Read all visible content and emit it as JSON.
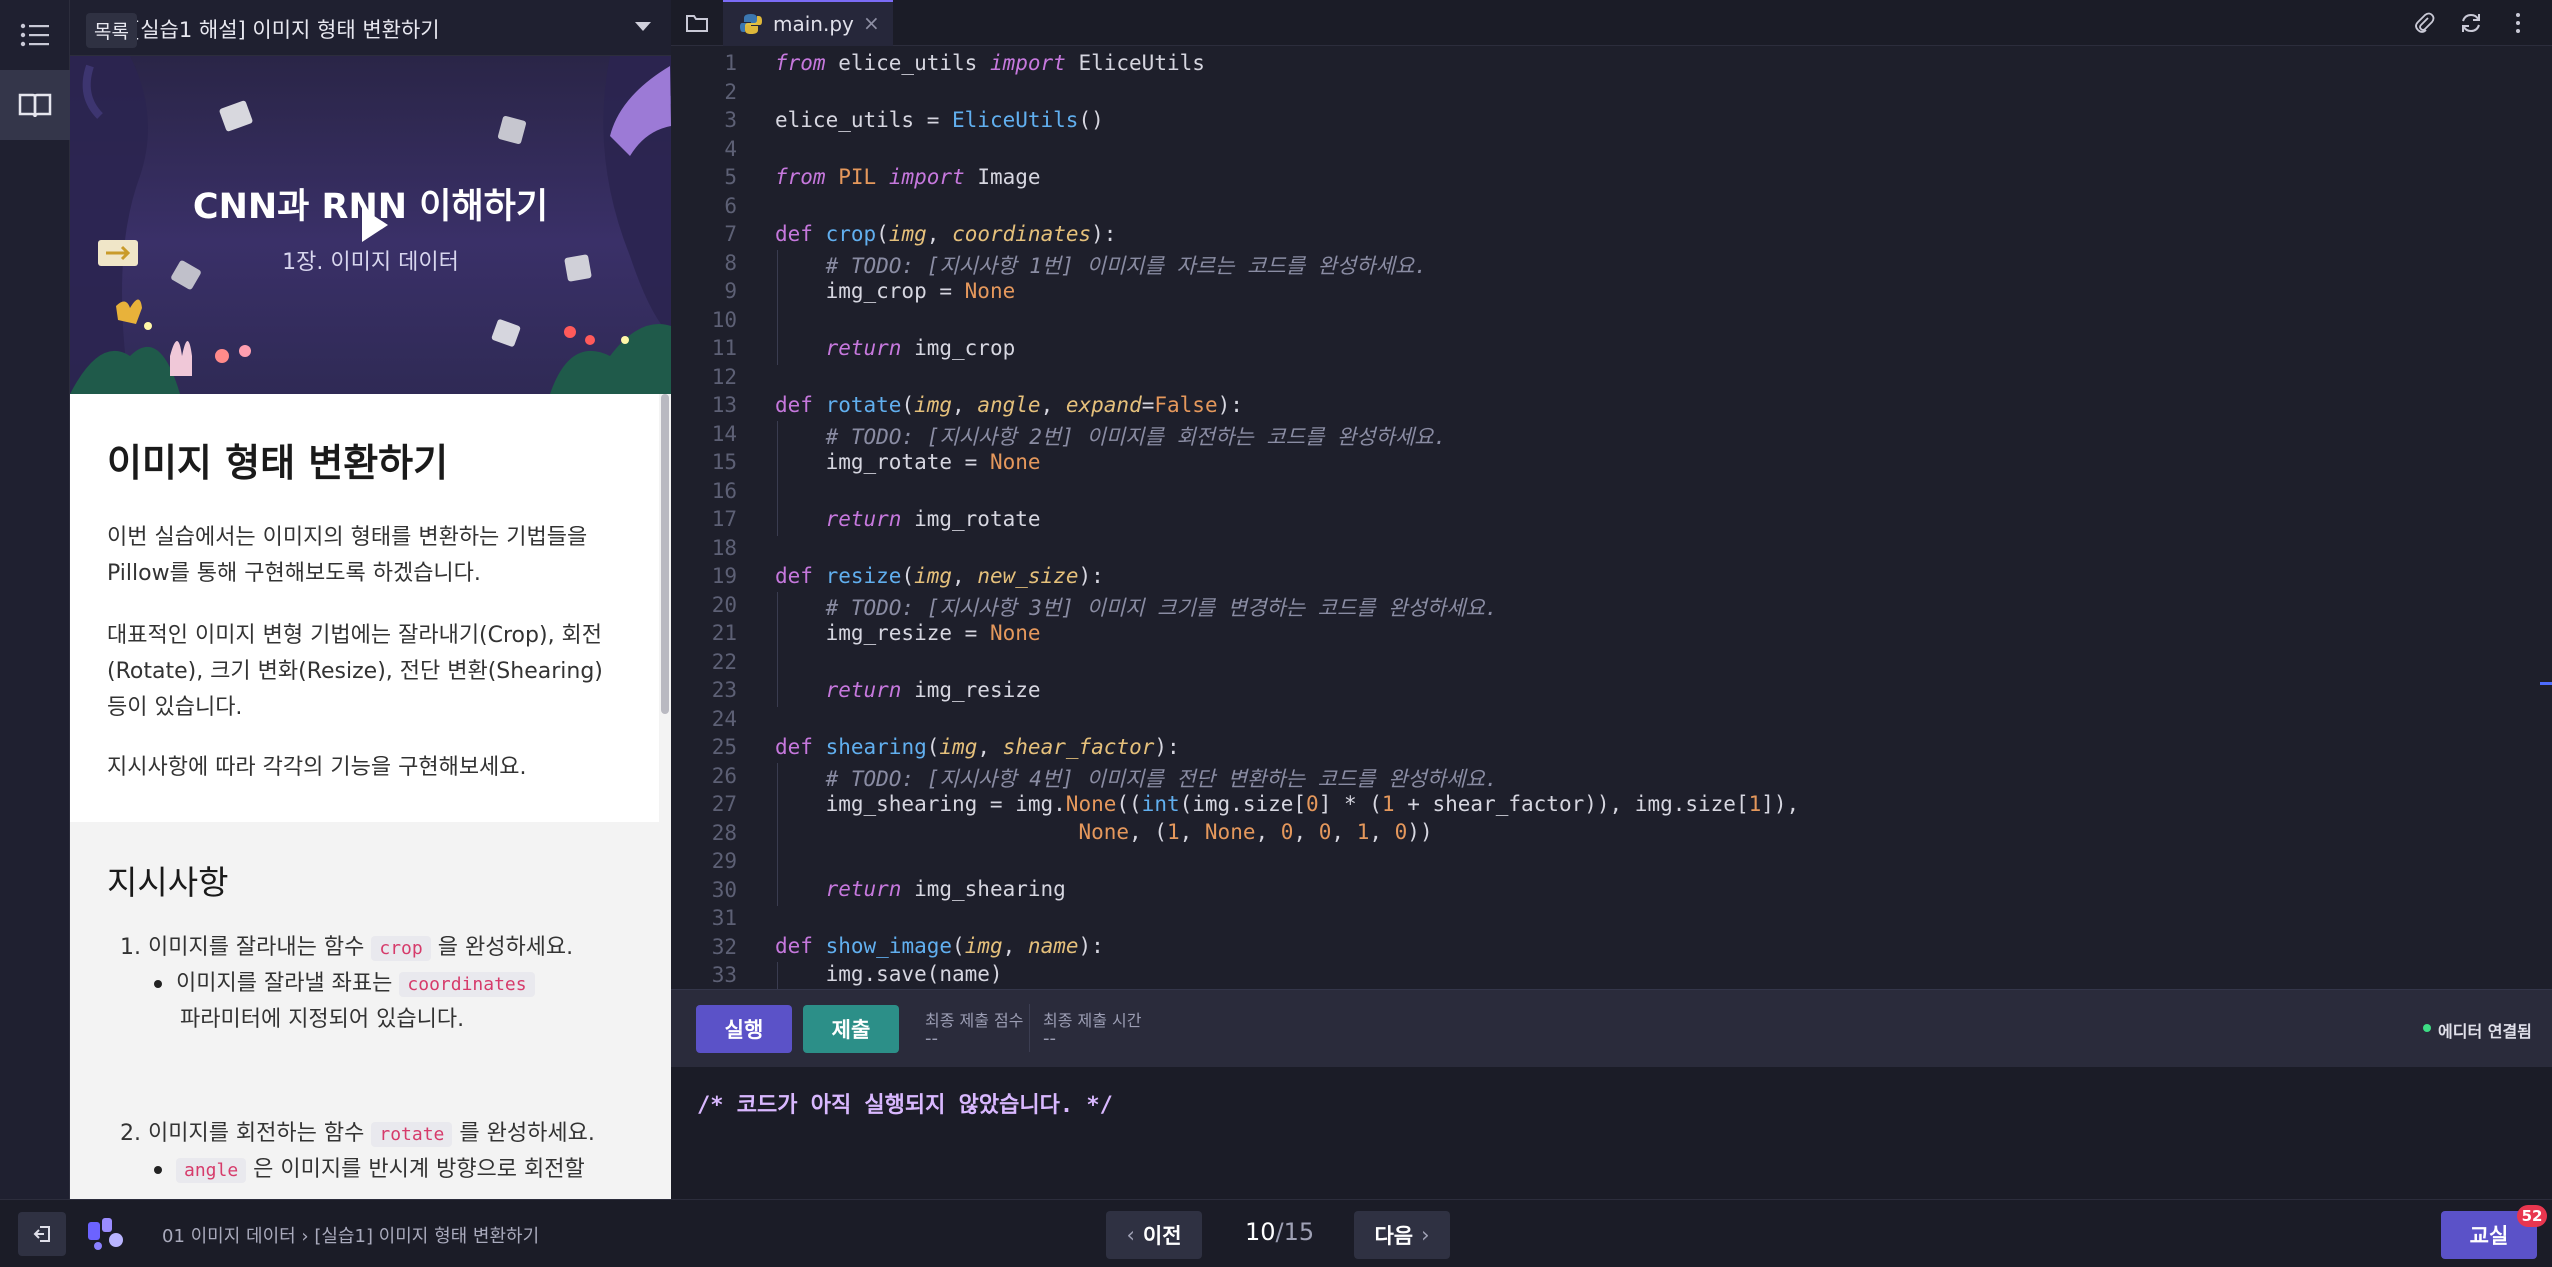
{
  "lesson_header": {
    "tooltip": "목록",
    "title": "[실습1 해설] 이미지 형태 변환하기"
  },
  "banner": {
    "title": "CNN과 RNN 이해하기",
    "subtitle": "1장.  이미지 데이터"
  },
  "content": {
    "heading": "이미지 형태 변환하기",
    "para1": "이번 실습에서는 이미지의 형태를 변환하는 기법들을 Pillow를 통해 구현해보도록 하겠습니다.",
    "para2": "대표적인 이미지 변형 기법에는 잘라내기(Crop), 회전(Rotate), 크기 변화(Resize), 전단 변환(Shearing) 등이 있습니다.",
    "para3": "지시사항에 따라 각각의 기능을 구현해보세요.",
    "instructions_heading": "지시사항",
    "items": [
      {
        "prefix": "1. 이미지를 잘라내는 함수 ",
        "code": "crop",
        "suffix": " 을 완성하세요.",
        "sub_prefix": "이미지를 잘라낼 좌표는 ",
        "sub_code": "coordinates",
        "sub_suffix": "파라미터에 지정되어 있습니다."
      },
      {
        "prefix": "2. 이미지를 회전하는 함수 ",
        "code": "rotate",
        "suffix": " 를 완성하세요.",
        "sub_code": "angle",
        "sub_suffix": " 은 이미지를 반시계 방향으로 회전할"
      }
    ]
  },
  "editor": {
    "tab_label": "main.py",
    "tab_close": "×",
    "line_numbers": [
      "1",
      "2",
      "3",
      "4",
      "5",
      "6",
      "7",
      "8",
      "9",
      "10",
      "11",
      "12",
      "13",
      "14",
      "15",
      "16",
      "17",
      "18",
      "19",
      "20",
      "21",
      "22",
      "23",
      "24",
      "25",
      "26",
      "27",
      "28",
      "29",
      "30",
      "31",
      "32",
      "33"
    ]
  },
  "runbar": {
    "run_label": "실행",
    "submit_label": "제출",
    "score_label": "최종 제출 점수",
    "score_value": "--",
    "time_label": "최종 제출 시간",
    "time_value": "--",
    "status": "에디터 연결됨"
  },
  "console": {
    "output": "/* 코드가 아직 실행되지 않았습니다. */"
  },
  "footer": {
    "breadcrumb": "01 이미지 데이터  ›  [실습1] 이미지 형태 변환하기",
    "prev_label": "이전",
    "next_label": "다음",
    "page_current": "10",
    "page_total": "/15",
    "classroom_label": "교실",
    "notification_count": "52"
  },
  "colors": {
    "accent": "#7b6cf6",
    "run_button": "#5b52c8",
    "submit_button": "#2c8f88",
    "status_dot": "#3ddc84",
    "badge": "#e8364f"
  }
}
